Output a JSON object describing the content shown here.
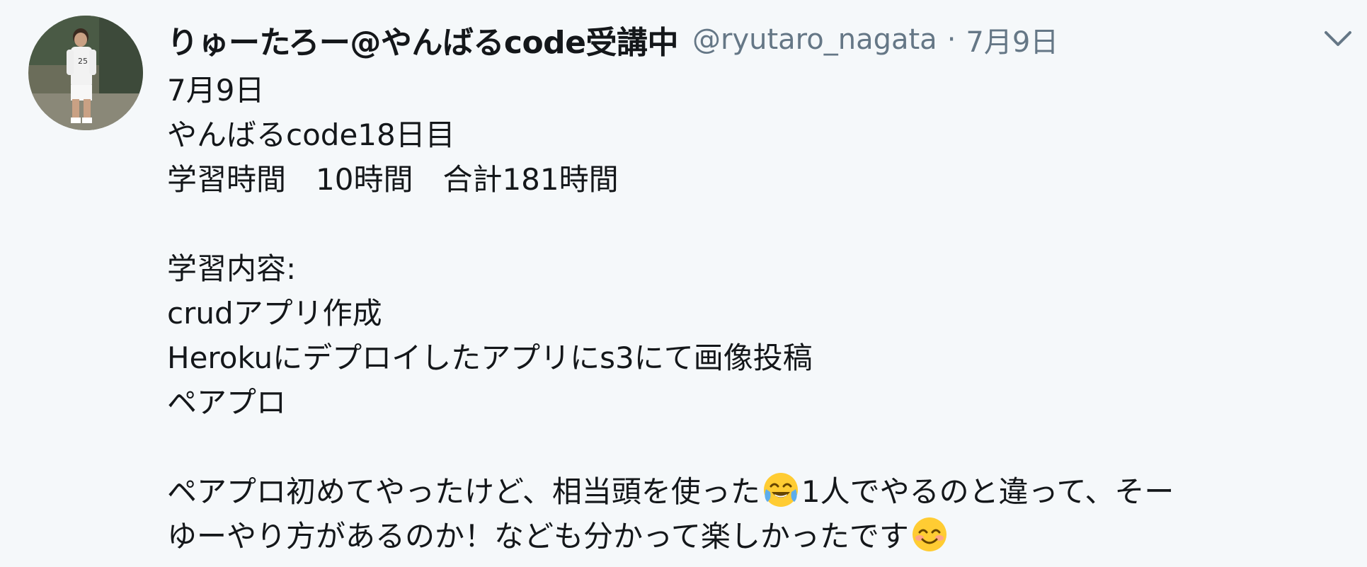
{
  "tweet": {
    "display_name": "りゅーたろー@やんばるcode受講中",
    "handle": "@ryutaro_nagata",
    "separator": "·",
    "timestamp": "7月9日",
    "lines": [
      "7月9日",
      "やんばるcode18日目",
      "学習時間　10時間　合計181時間",
      "",
      "学習内容:",
      "crudアプリ作成",
      "Herokuにデプロイしたアプリにs3にて画像投稿",
      "ペアプロ",
      "",
      "ペアプロ初めてやったけど、相当頭を使った",
      "1人でやるのと違って、そーゆーやり方があるのか！なども分かって楽しかったです"
    ],
    "line_9a": "ペアプロ初めてやったけど、相当頭を使った",
    "line_9b": "1人でやるのと違って、そー",
    "line_10a": "ゆーやり方があるのか！なども分かって楽しかったです",
    "icons": {
      "caret": "chevron-down-icon",
      "emoji1": "face-with-tears-of-joy-emoji",
      "emoji2": "smiling-face-with-smiling-eyes-emoji"
    },
    "colors": {
      "background": "#f5f8fa",
      "text": "#14171a",
      "secondary": "#657786"
    }
  }
}
